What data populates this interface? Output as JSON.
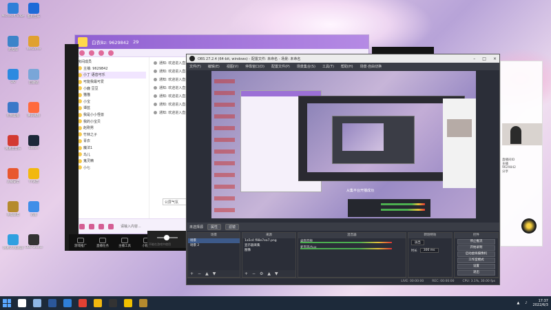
{
  "desktop_icons": [
    {
      "label": "Microsoft Edge",
      "color": "#2f7fd8"
    },
    {
      "label": "酷狗音乐",
      "color": "#1d6ad8"
    },
    {
      "label": "此电脑",
      "color": "#3c84c9"
    },
    {
      "label": "WeGame",
      "color": "#e0a130"
    },
    {
      "label": "QQ",
      "color": "#2d8ae0"
    },
    {
      "label": "回收站",
      "color": "#7aa6d8"
    },
    {
      "label": "控制面板",
      "color": "#3a78c8"
    },
    {
      "label": "腾讯视频",
      "color": "#ff6a3d"
    },
    {
      "label": "网易云音乐",
      "color": "#d33a31"
    },
    {
      "label": "Steam",
      "color": "#1b2838"
    },
    {
      "label": "火绒安全",
      "color": "#e8572f"
    },
    {
      "label": "YY语音",
      "color": "#f2b80f"
    },
    {
      "label": "英雄联盟",
      "color": "#b58a2e"
    },
    {
      "label": "迅雷",
      "color": "#3f8ee8"
    },
    {
      "label": "网易UU加速器",
      "color": "#2fa0e0"
    },
    {
      "label": "OBS Studio",
      "color": "#333333"
    }
  ],
  "chat_window": {
    "room_label": "白衣Bz: 9629842",
    "room_id": "9629842",
    "online_count": "29",
    "section_label": "房间成员",
    "members": [
      "主播: 9629842",
      "小丁 语音可乐",
      "可能我最可爱",
      "小鹿 豆豆",
      "猫猫",
      "小宝",
      "谭蓝",
      "我是小小怪兽",
      "我的小宝贝",
      "赵刚男",
      "竹林之子",
      "青衣",
      "魔法1",
      "鸟儿",
      "鬼灵精",
      "小七"
    ],
    "messages": [
      "通知: 欢迎进入直播间",
      "通知: 欢迎进入直播间",
      "通知: 欢迎进入直播间",
      "通知: 欢迎进入直播间",
      "通知: 欢迎进入直播间",
      "通知: 欢迎进入直播间",
      "通知: 欢迎进入直播间"
    ],
    "public_chat": "公屏气氛",
    "input_hint": "请输入内容..."
  },
  "dark_panel": {
    "tools": [
      "游戏推广",
      "直播任务",
      "主播工具",
      "小程序"
    ],
    "volume_hint": "不能在游戏中使用"
  },
  "obs": {
    "title": "OBS 27.2.4 (64-bit, windows) - 配置文件: 未命名 - 场景: 未命名",
    "menus": [
      "文件(F)",
      "编辑(E)",
      "视图(V)",
      "停靠窗口(D)",
      "配置文件(P)",
      "场景集合(S)",
      "工具(T)",
      "帮助(H)",
      "场景·自由切换"
    ],
    "preview_caption": "从集平台开播成功",
    "scene_bar_label": "未选择源",
    "scene_bar_buttons": [
      "属性",
      "滤镜"
    ],
    "docks": {
      "scenes": {
        "header": "场景",
        "items": [
          "场景",
          "场景 2"
        ]
      },
      "sources": {
        "header": "来源",
        "items": [
          "1a5c4 f98e7ea7.png",
          "显示器采集",
          "图像"
        ]
      },
      "mixer": {
        "header": "混音器",
        "channels": [
          "桌面音频",
          "麦克风/Aux"
        ]
      },
      "transitions": {
        "header": "转场特效",
        "type": "淡出",
        "duration_label": "时长",
        "duration": "300 ms"
      },
      "controls": {
        "header": "控件",
        "buttons": [
          "停止推流",
          "开始录制",
          "启动虚拟摄像机",
          "工作室模式",
          "设置",
          "退出"
        ]
      }
    },
    "status": {
      "live": "LIVE: 00:00:00",
      "rec": "REC: 00:00:00",
      "cpu": "CPU: 3.1%, 30.00 fps"
    }
  },
  "right_panel": {
    "lines": [
      "直播间ID",
      "主播",
      "9629842",
      "分享"
    ]
  },
  "taskbar": {
    "time": "17:37",
    "date": "2022/6/3",
    "apps": [
      {
        "name": "search-icon",
        "color": "#ffffff"
      },
      {
        "name": "task-view-icon",
        "color": "#8fb7e6"
      },
      {
        "name": "word-icon",
        "color": "#2b579a"
      },
      {
        "name": "edge-icon",
        "color": "#2f7fd8"
      },
      {
        "name": "chrome-icon",
        "color": "#e34133"
      },
      {
        "name": "qq-icon",
        "color": "#f2b80f"
      },
      {
        "name": "obs-icon",
        "color": "#333333"
      },
      {
        "name": "yy-icon",
        "color": "#f0c000"
      },
      {
        "name": "game-icon",
        "color": "#b58a2e"
      }
    ]
  }
}
